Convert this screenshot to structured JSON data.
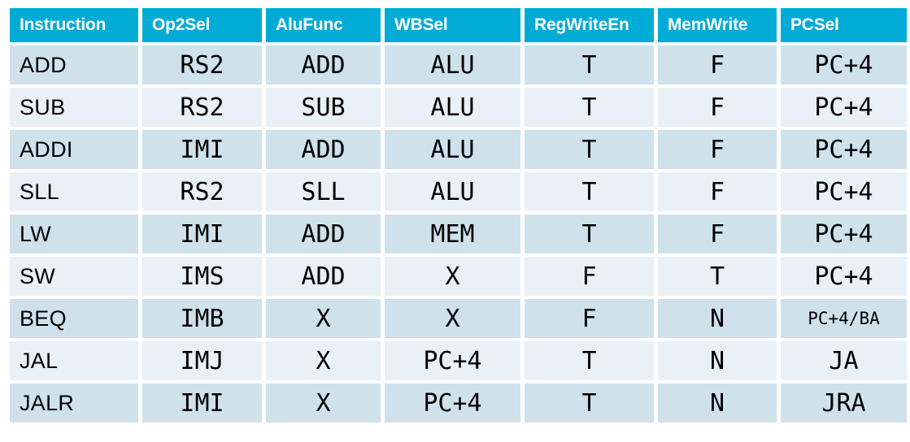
{
  "table": {
    "columns": [
      {
        "key": "instruction",
        "label": "Instruction"
      },
      {
        "key": "op2sel",
        "label": "Op2Sel"
      },
      {
        "key": "alufunc",
        "label": "AluFunc"
      },
      {
        "key": "wbsel",
        "label": "WBSel"
      },
      {
        "key": "regwriteen",
        "label": "RegWriteEn"
      },
      {
        "key": "memwrite",
        "label": "MemWrite"
      },
      {
        "key": "pcsel",
        "label": "PCSel"
      }
    ],
    "rows": [
      {
        "instruction": "ADD",
        "op2sel": "RS2",
        "alufunc": "ADD",
        "wbsel": "ALU",
        "regwriteen": "T",
        "memwrite": "F",
        "pcsel": "PC+4"
      },
      {
        "instruction": "SUB",
        "op2sel": "RS2",
        "alufunc": "SUB",
        "wbsel": "ALU",
        "regwriteen": "T",
        "memwrite": "F",
        "pcsel": "PC+4"
      },
      {
        "instruction": "ADDI",
        "op2sel": "IMI",
        "alufunc": "ADD",
        "wbsel": "ALU",
        "regwriteen": "T",
        "memwrite": "F",
        "pcsel": "PC+4"
      },
      {
        "instruction": "SLL",
        "op2sel": "RS2",
        "alufunc": "SLL",
        "wbsel": "ALU",
        "regwriteen": "T",
        "memwrite": "F",
        "pcsel": "PC+4"
      },
      {
        "instruction": "LW",
        "op2sel": "IMI",
        "alufunc": "ADD",
        "wbsel": "MEM",
        "regwriteen": "T",
        "memwrite": "F",
        "pcsel": "PC+4"
      },
      {
        "instruction": "SW",
        "op2sel": "IMS",
        "alufunc": "ADD",
        "wbsel": "X",
        "regwriteen": "F",
        "memwrite": "T",
        "pcsel": "PC+4"
      },
      {
        "instruction": "BEQ",
        "op2sel": "IMB",
        "alufunc": "X",
        "wbsel": "X",
        "regwriteen": "F",
        "memwrite": "N",
        "pcsel": "PC+4/BA"
      },
      {
        "instruction": "JAL",
        "op2sel": "IMJ",
        "alufunc": "X",
        "wbsel": "PC+4",
        "regwriteen": "T",
        "memwrite": "N",
        "pcsel": "JA"
      },
      {
        "instruction": "JALR",
        "op2sel": "IMI",
        "alufunc": "X",
        "wbsel": "PC+4",
        "regwriteen": "T",
        "memwrite": "N",
        "pcsel": "JRA"
      }
    ]
  },
  "colors": {
    "header_background": "#00ACD6",
    "header_text": "#FFFFFF",
    "row_odd_background": "#CFE2EC",
    "row_even_background": "#E9F0F6",
    "cell_text": "#000000",
    "page_background": "#FFFFFF"
  }
}
